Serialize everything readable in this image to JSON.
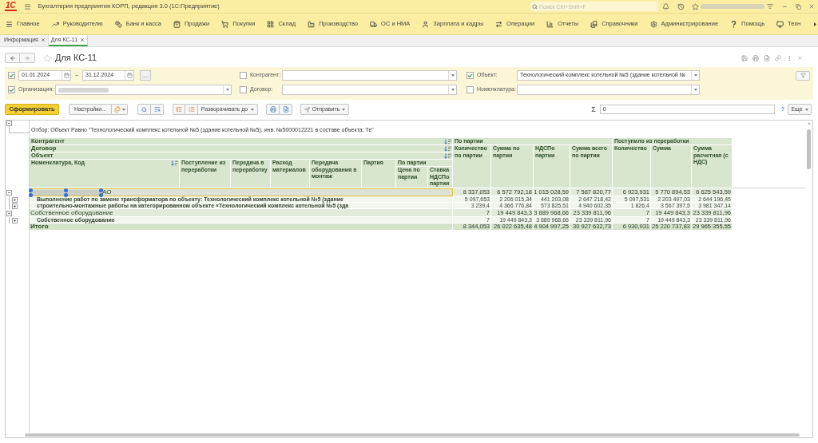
{
  "app": {
    "logo": "1С",
    "title": "Бухгалтерия предприятия КОРП, редакция 3.0 (1С:Предприятие)",
    "search": {
      "placeholder": "Поиск Ctrl+Shift+F"
    },
    "user_hidden": true
  },
  "sections": [
    {
      "label": "Главное"
    },
    {
      "label": "Руководителю"
    },
    {
      "label": "Банк и касса"
    },
    {
      "label": "Продажи"
    },
    {
      "label": "Покупки"
    },
    {
      "label": "Склад"
    },
    {
      "label": "Производство"
    },
    {
      "label": "ОС и НМА"
    },
    {
      "label": "Зарплата и кадры"
    },
    {
      "label": "Операции"
    },
    {
      "label": "Отчеты"
    },
    {
      "label": "Справочники"
    },
    {
      "label": "Администрирование"
    },
    {
      "label": "Помощь"
    },
    {
      "label": "Техн"
    }
  ],
  "open_tabs": [
    {
      "label": "Информация",
      "selected": false
    },
    {
      "label": "Для КС-11",
      "selected": true
    }
  ],
  "form": {
    "title": "Для КС-11",
    "favorite": false
  },
  "filters": {
    "rows": [
      [
        {
          "kind": "period",
          "checked": true,
          "from": "01.01.2024",
          "separator": "–",
          "to": "31.12.2024",
          "button": "..."
        },
        {
          "kind": "select",
          "checked": false,
          "label": "Контрагент:"
        },
        {
          "kind": "select",
          "checked": true,
          "label": "Объект:",
          "value": "Технологический комплекс котельной №5 (здание котельной №"
        }
      ],
      [
        {
          "kind": "select",
          "checked": true,
          "label": "Организация:",
          "value_hidden": true
        },
        {
          "kind": "select",
          "checked": false,
          "label": "Договор:"
        },
        {
          "kind": "select",
          "checked": false,
          "label": "Номенклатура:"
        }
      ]
    ]
  },
  "toolbar": {
    "generate": "Сформировать",
    "settings": "Настройки...",
    "expand_to": "Разворачивать до",
    "send": "Отправить",
    "sum_symbol": "Σ",
    "sum_value": "0",
    "help": "?",
    "more": "Еще"
  },
  "report": {
    "expanded": true,
    "filter_note": "Отбор: Объект Равно \"Технологический комплекс котельной №5 (здание котельной №5), инв. №5000012221 в составе объекта: Те\"",
    "grouping": [
      {
        "label": "Контрагент"
      },
      {
        "label": "Договор"
      },
      {
        "label": "Объект"
      }
    ],
    "item_column": "Номенклатура, Код",
    "left_columns": [
      "Поступление из переработки",
      "Передача в переработку",
      "Расход материалов",
      "Передача оборудования в монтаж",
      "Партия"
    ],
    "left_group": {
      "label": "По партии",
      "columns": [
        "Цена по партии",
        "Ставка НДСПо партии"
      ]
    },
    "groups": [
      {
        "label": "По партии",
        "columns": [
          "Количество по партии",
          "Сумма по партии",
          "НДСПо партии",
          "Сумма всего по партии"
        ]
      },
      {
        "label": "Поступило из переработки",
        "columns": [
          "Количество",
          "Сумма",
          "Сумма расчетная (с НДС)"
        ]
      }
    ],
    "rows": [
      {
        "kind": "group",
        "label": "АО",
        "label_redacted": true,
        "expanded": true,
        "selected": true,
        "values": [
          "8 337,053",
          "6 572 792,18",
          "1 015 028,59",
          "7 587 820,77",
          "6 923,931",
          "5 770 894,53",
          "6 625 543,59"
        ]
      },
      {
        "kind": "detail",
        "label": "Выполнение работ по замене трансформатора по объекту: Технологический комплекс котельной №5 (здание",
        "label_redacted": false,
        "expanded": false,
        "selected": false,
        "values": [
          "5 097,653",
          "2 206 015,34",
          "441 203,08",
          "2 647 218,42",
          "5 097,531",
          "2 203 497,03",
          "2 644 196,45"
        ]
      },
      {
        "kind": "detail",
        "label": "строительно-монтажные работы на категорированном объекте «Технологический комплекс котельной №5 (зда",
        "label_redacted": false,
        "expanded": false,
        "selected": false,
        "values": [
          "3 239,4",
          "4 366 776,84",
          "573 825,51",
          "4 940 602,35",
          "1 826,4",
          "3 567 397,5",
          "3 981 347,14"
        ]
      },
      {
        "kind": "group",
        "label": "Собственное оборудование",
        "label_redacted": false,
        "expanded": true,
        "selected": false,
        "values": [
          "7",
          "19 449 843,3",
          "3 889 968,66",
          "23 339 811,96",
          "7",
          "19 449 843,3",
          "23 339 811,96"
        ]
      },
      {
        "kind": "detail",
        "label": "Собственное оборудование",
        "label_redacted": false,
        "expanded": false,
        "selected": false,
        "values": [
          "7",
          "19 449 843,3",
          "3 889 968,66",
          "23 339 811,96",
          "7",
          "19 449 843,3",
          "23 339 811,96"
        ]
      },
      {
        "kind": "total",
        "label": "Итого",
        "label_redacted": false,
        "selected": false,
        "values": [
          "8 344,053",
          "26 022 635,48",
          "4 904 997,25",
          "30 927 632,73",
          "6 930,931",
          "25 220 737,83",
          "29 965 355,55"
        ]
      }
    ]
  }
}
